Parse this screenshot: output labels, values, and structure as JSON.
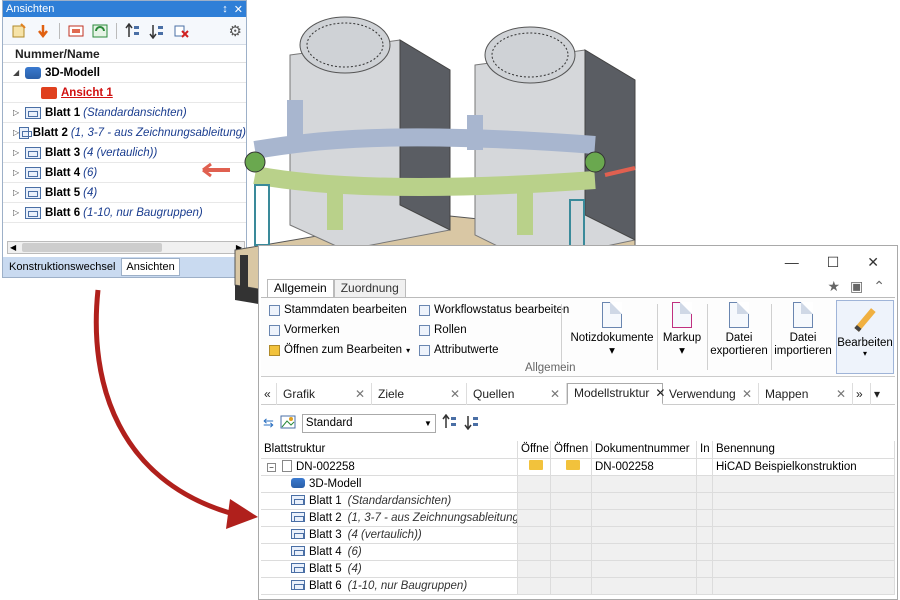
{
  "ansichten": {
    "title": "Ansichten",
    "pin": "↕",
    "close": "✕",
    "column_header": "Nummer/Name",
    "tree": [
      {
        "label": "3D-Modell",
        "sub": "",
        "icon": "model"
      },
      {
        "label": "Ansicht 1",
        "sub": "",
        "icon": "view"
      },
      {
        "label": "Blatt 1",
        "sub": "(Standardansichten)",
        "icon": "sheet"
      },
      {
        "label": "Blatt 2",
        "sub": "(1, 3-7 - aus Zeichnungsableitung)",
        "icon": "sheet"
      },
      {
        "label": "Blatt 3",
        "sub": "(4 (vertaulich))",
        "icon": "sheet"
      },
      {
        "label": "Blatt 4",
        "sub": "(6)",
        "icon": "sheet"
      },
      {
        "label": "Blatt 5",
        "sub": "(4)",
        "icon": "sheet"
      },
      {
        "label": "Blatt 6",
        "sub": "(1-10, nur Baugruppen)",
        "icon": "sheet"
      }
    ],
    "bottom_tabs": [
      "Konstruktionswechsel",
      "Ansichten"
    ]
  },
  "window": {
    "controls": {
      "minimize": "—",
      "maximize": "☐",
      "close": "✕"
    },
    "ribbon_tabs": [
      "Allgemein",
      "Zuordnung"
    ],
    "ribbon": {
      "small_buttons": [
        "Stammdaten bearbeiten",
        "Vormerken",
        "Öffnen zum Bearbeiten",
        "Workflowstatus bearbeiten",
        "Rollen",
        "Attributwerte"
      ],
      "big_buttons": [
        {
          "line1": "Notizdokumente",
          "line2": "▾"
        },
        {
          "line1": "Markup",
          "line2": "▾"
        },
        {
          "line1": "Datei",
          "line2": "exportieren"
        },
        {
          "line1": "Datei",
          "line2": "importieren"
        }
      ],
      "group_label": "Allgemein",
      "edit_button": "Bearbeiten"
    },
    "doc_tabs": [
      "Grafik",
      "Ziele",
      "Quellen",
      "Modellstruktur",
      "Verwendung",
      "Mappen"
    ],
    "active_doc_tab": "Modellstruktur",
    "filter_select": "Standard",
    "grid": {
      "headers": [
        "Blattstruktur",
        "Öffne",
        "Öffnen",
        "Dokumentnummer",
        "In",
        "Benennung"
      ],
      "rows": [
        {
          "name": "DN-002258",
          "tag": "",
          "doknr": "DN-002258",
          "benennung": "HiCAD Beispielkonstruktion"
        },
        {
          "name": "3D-Modell",
          "tag": "",
          "doknr": "",
          "benennung": ""
        },
        {
          "name": "Blatt 1",
          "tag": "(Standardansichten)",
          "doknr": "",
          "benennung": ""
        },
        {
          "name": "Blatt 2",
          "tag": "(1, 3-7 - aus Zeichnungsableitung)",
          "doknr": "",
          "benennung": ""
        },
        {
          "name": "Blatt 3",
          "tag": "(4 (vertaulich))",
          "doknr": "",
          "benennung": ""
        },
        {
          "name": "Blatt 4",
          "tag": "(6)",
          "doknr": "",
          "benennung": ""
        },
        {
          "name": "Blatt 5",
          "tag": "(4)",
          "doknr": "",
          "benennung": ""
        },
        {
          "name": "Blatt 6",
          "tag": "(1-10, nur Baugruppen)",
          "doknr": "",
          "benennung": ""
        }
      ]
    }
  },
  "colors": {
    "titlebar": "#2f7fd7",
    "arrow": "#b0201c",
    "accent_red": "#d01010"
  }
}
